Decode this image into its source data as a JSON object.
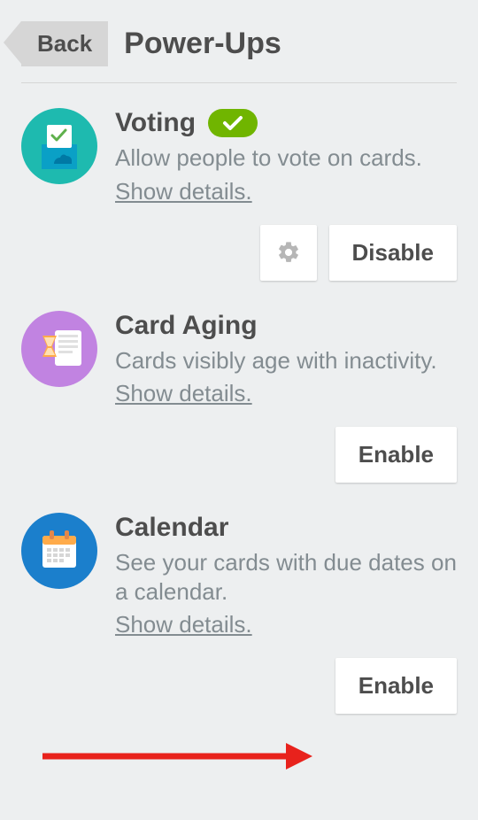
{
  "header": {
    "back": "Back",
    "title": "Power-Ups"
  },
  "powerups": [
    {
      "name": "Voting",
      "desc": "Allow people to vote on cards.",
      "details": "Show details.",
      "enabled": true,
      "actions": {
        "settings_icon": "gear-icon",
        "primary": "Disable"
      }
    },
    {
      "name": "Card Aging",
      "desc": "Cards visibly age with inactivity.",
      "details": "Show details.",
      "enabled": false,
      "actions": {
        "primary": "Enable"
      }
    },
    {
      "name": "Calendar",
      "desc": "See your cards with due dates on a calendar.",
      "details": "Show details.",
      "enabled": false,
      "actions": {
        "primary": "Enable"
      }
    }
  ]
}
